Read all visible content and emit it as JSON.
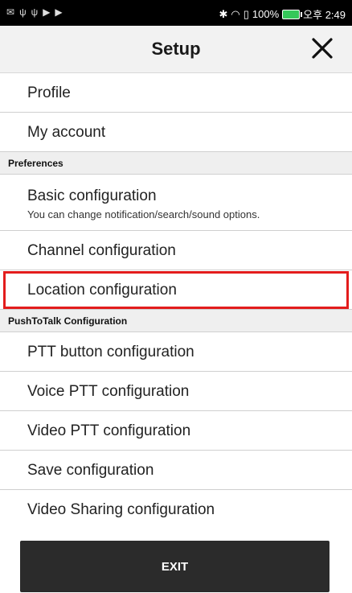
{
  "status_bar": {
    "left_icons": [
      "notification-icon",
      "usb-icon",
      "usb-icon",
      "play-store-icon",
      "play-store-icon"
    ],
    "right_text": "100%",
    "time": "오후 2:49",
    "icons": [
      "bluetooth-icon",
      "wifi-icon",
      "signal-icon",
      "battery-icon"
    ]
  },
  "header": {
    "title": "Setup",
    "close_icon": "close-icon"
  },
  "items": {
    "profile": "Profile",
    "my_account": "My account",
    "preferences_section": "Preferences",
    "basic_configuration": "Basic configuration",
    "basic_configuration_sub": "You can change notification/search/sound options.",
    "channel_configuration": "Channel configuration",
    "location_configuration": "Location configuration",
    "ptt_section": "PushToTalk Configuration",
    "ptt_button_configuration": "PTT button configuration",
    "voice_ptt_configuration": "Voice PTT configuration",
    "video_ptt_configuration": "Video PTT configuration",
    "save_configuration": "Save configuration",
    "video_sharing_configuration": "Video Sharing configuration"
  },
  "exit_button": "EXIT",
  "colors": {
    "highlight": "#e31c1c",
    "exit_bg": "#2b2b2b",
    "header_bg": "#f2f2f2",
    "section_bg": "#efefef"
  }
}
